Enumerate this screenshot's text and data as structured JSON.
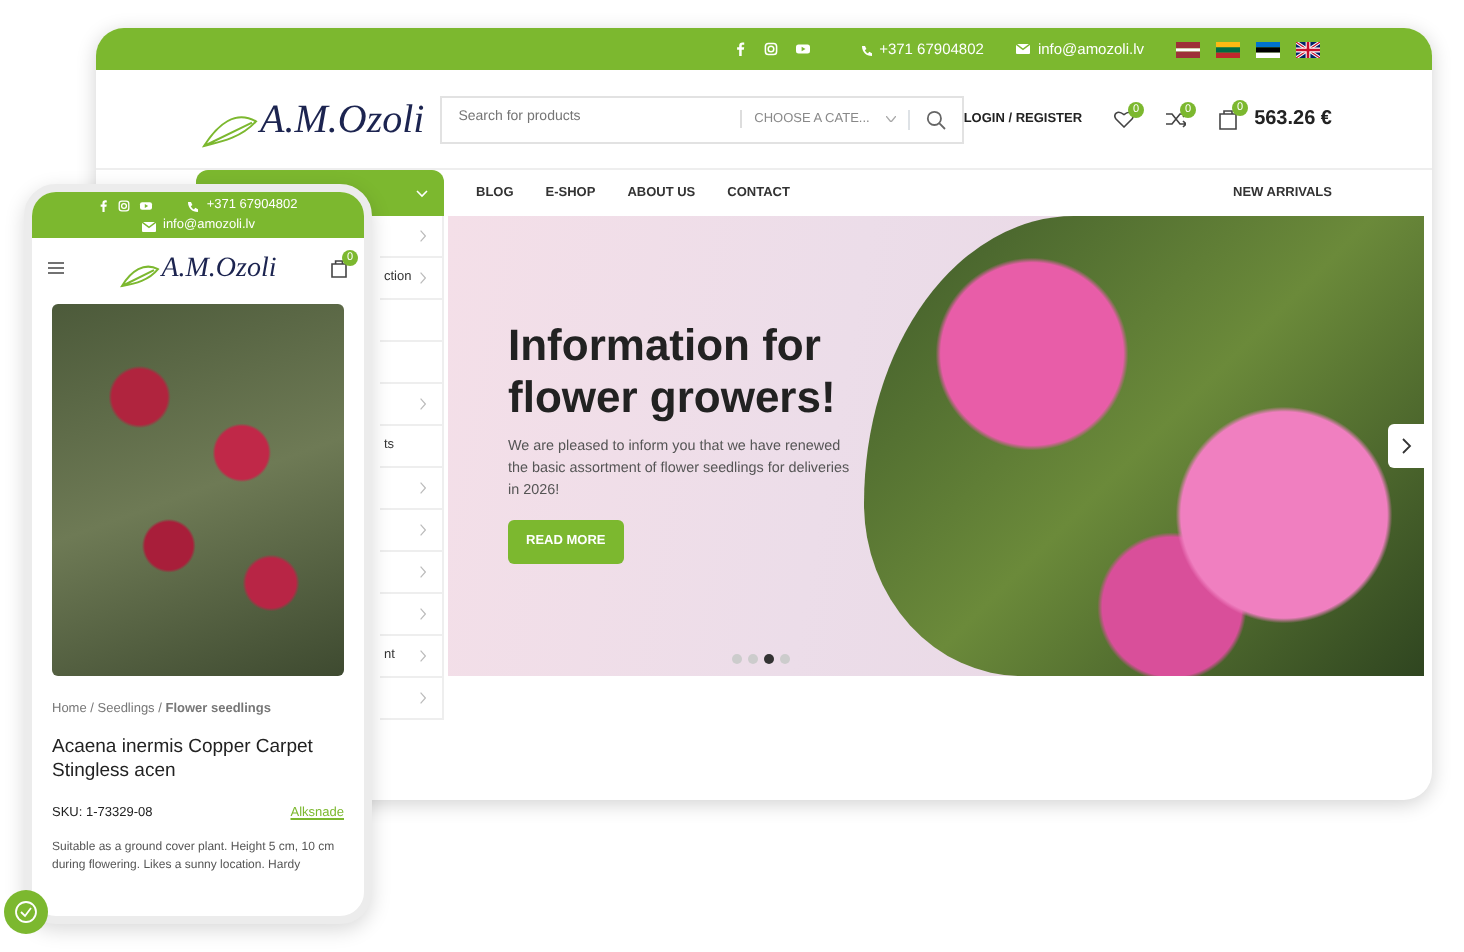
{
  "desktop": {
    "top_bar": {
      "phone": "+371 67904802",
      "email": "info@amozoli.lv"
    },
    "logo": "A.M.Ozoli",
    "search": {
      "placeholder": "Search for products",
      "category": "CHOOSE A CATE..."
    },
    "login": "LOGIN / REGISTER",
    "wishlist_count": "0",
    "compare_count": "0",
    "cart_count": "0",
    "cart_total": "563.26 €",
    "nav": [
      "BLOG",
      "E-SHOP",
      "ABOUT US",
      "CONTACT"
    ],
    "nav_right": "NEW ARRIVALS",
    "sidebar": {
      "items": [
        {
          "submenu": true
        },
        {
          "label": "ction",
          "submenu": true
        },
        {
          "submenu": false
        },
        {
          "submenu": false
        },
        {
          "submenu": true
        },
        {
          "label": "ts",
          "submenu": false
        },
        {
          "submenu": true
        },
        {
          "submenu": true
        },
        {
          "submenu": true
        },
        {
          "submenu": true
        },
        {
          "label": "nt",
          "submenu": true
        },
        {
          "submenu": true
        }
      ]
    },
    "hero": {
      "title": "Information for flower growers!",
      "text": "We are pleased to inform you that we have renewed the basic assortment of flower seedlings for deliveries in 2026!",
      "button": "READ MORE",
      "slides": [
        {
          "selected": false
        },
        {
          "selected": false
        },
        {
          "selected": true
        },
        {
          "selected": false
        }
      ]
    }
  },
  "mobile": {
    "top_bar": {
      "phone": "+371 67904802",
      "email": "info@amozoli.lv"
    },
    "logo": "A.M.Ozoli",
    "cart_count": "0",
    "breadcrumb": "Home / Seedlings / **Flower seedlings**",
    "title": "Acaena inermis Copper Carpet Stingless acen",
    "sku": "SKU: 1-73329-08",
    "brand": "Alksnade",
    "description": "Suitable as a ground cover plant. Height 5 cm, 10 cm during flowering. Likes a sunny location. Hardy"
  }
}
